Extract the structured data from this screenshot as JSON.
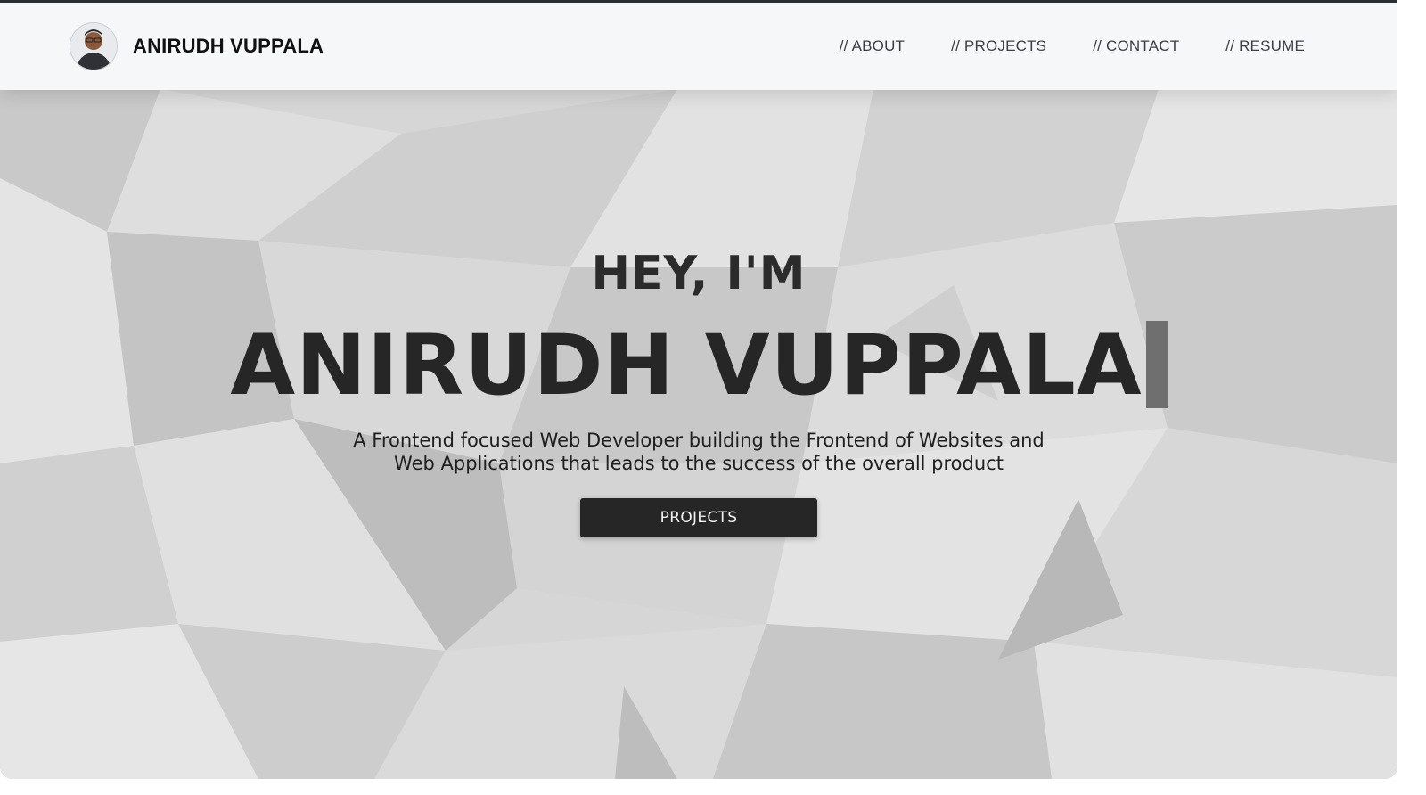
{
  "brand": {
    "name": "ANIRUDH VUPPALA"
  },
  "nav": {
    "items": [
      {
        "label": "// ABOUT"
      },
      {
        "label": "// PROJECTS"
      },
      {
        "label": "// CONTACT"
      },
      {
        "label": "// RESUME"
      }
    ]
  },
  "hero": {
    "greeting": "HEY, I'M",
    "name": "ANIRUDH VUPPALA",
    "tagline_line1": "A Frontend focused Web Developer building the Frontend of Websites and",
    "tagline_line2": "Web Applications that leads to the success of the overall product",
    "cta_label": "PROJECTS"
  },
  "icons": {
    "avatar": "profile-photo",
    "cursor": "typing-cursor"
  },
  "colors": {
    "topline": "#2a2f36",
    "navbar_bg": "#f6f7f9",
    "text_dark": "#262626",
    "button_bg": "#262626",
    "button_text": "#f2f2f2"
  }
}
